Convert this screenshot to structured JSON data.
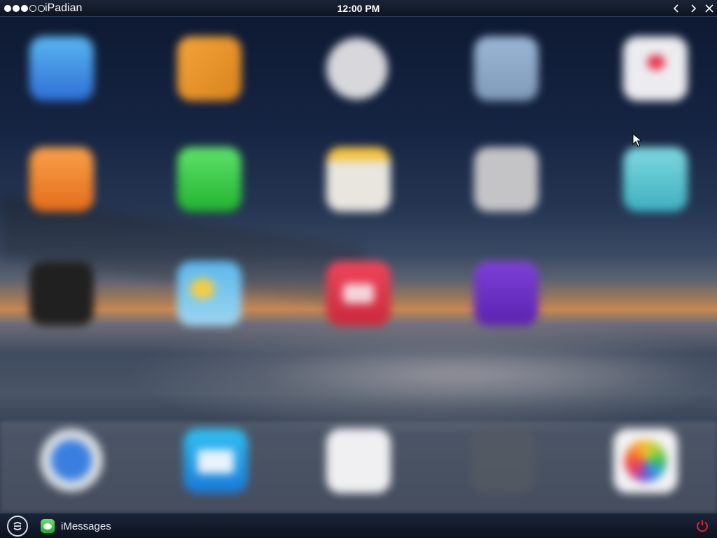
{
  "statusbar": {
    "app_title": "iPadian",
    "clock": "12:00 PM",
    "signal_dots": [
      "filled",
      "filled",
      "filled",
      "empty",
      "empty"
    ]
  },
  "home_screen": {
    "icons": [
      {
        "name": "app-store-icon"
      },
      {
        "name": "pages-icon"
      },
      {
        "name": "clock-icon"
      },
      {
        "name": "maps-icon"
      },
      {
        "name": "health-icon"
      },
      {
        "name": "ibooks-icon"
      },
      {
        "name": "messages-icon"
      },
      {
        "name": "notes-icon"
      },
      {
        "name": "settings-icon"
      },
      {
        "name": "calendar-icon"
      },
      {
        "name": "dark-app-icon"
      },
      {
        "name": "weather-icon"
      },
      {
        "name": "videos-icon"
      },
      {
        "name": "podcasts-icon"
      }
    ],
    "dock": [
      {
        "name": "safari-icon"
      },
      {
        "name": "mail-icon"
      },
      {
        "name": "game-center-icon"
      },
      {
        "name": "camera-icon"
      },
      {
        "name": "photos-icon"
      }
    ]
  },
  "taskbar": {
    "running_app_label": "iMessages",
    "colors": {
      "power": "#d9262e",
      "messages_green": "#2dbd3a"
    }
  }
}
